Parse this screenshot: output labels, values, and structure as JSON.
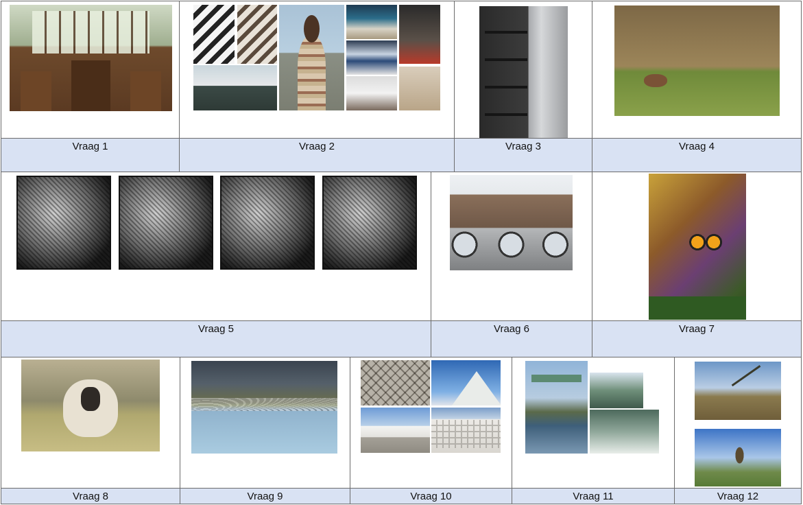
{
  "labels": {
    "q1": "Vraag 1",
    "q2": "Vraag 2",
    "q3": "Vraag 3",
    "q4": "Vraag 4",
    "q5": "Vraag 5",
    "q6": "Vraag 6",
    "q7": "Vraag 7",
    "q8": "Vraag 8",
    "q9": "Vraag 9",
    "q10": "Vraag 10",
    "q11": "Vraag 11",
    "q12": "Vraag 12"
  },
  "colors": {
    "label_background": "#d9e2f3",
    "border": "#6b6b6b"
  }
}
